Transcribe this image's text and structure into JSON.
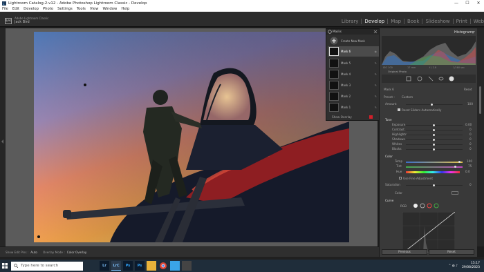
{
  "window": {
    "title": "Lightroom Catalog-2-v12 - Adobe Photoshop Lightroom Classic - Develop",
    "min": "—",
    "max": "☐",
    "close": "✕"
  },
  "menu": [
    "File",
    "Edit",
    "Develop",
    "Photo",
    "Settings",
    "Tools",
    "View",
    "Window",
    "Help"
  ],
  "identity": {
    "logo": "Lrc",
    "product": "Adobe Lightroom Classic",
    "user": "Jack Bird"
  },
  "modules": [
    "Library",
    "Develop",
    "Map",
    "Book",
    "Slideshow",
    "Print",
    "Web"
  ],
  "active_module": "Develop",
  "masks_panel": {
    "title": "Masks",
    "create": "Create New Mask",
    "items": [
      {
        "label": "Mask 6",
        "active": true
      },
      {
        "label": "Mask 5",
        "active": false
      },
      {
        "label": "Mask 4",
        "active": false
      },
      {
        "label": "Mask 3",
        "active": false
      },
      {
        "label": "Mask 2",
        "active": false
      },
      {
        "label": "Mask 1",
        "active": false
      }
    ],
    "show_overlay": "Show Overlay"
  },
  "histogram": {
    "title": "Histogram",
    "readout": [
      "ISO 100",
      "17 mm",
      "f / 2.8",
      "1/160 sec"
    ],
    "original_photo": "Original Photo"
  },
  "mask_panel": {
    "mask_label": "Mask 6",
    "reset": "Reset",
    "preset_label": "Preset :",
    "preset_value": "Custom",
    "amount_label": "Amount",
    "amount_value": "100",
    "reset_sliders": "Reset Sliders Automatically",
    "tone_section": "Tone",
    "tone_sliders": [
      {
        "label": "Exposure",
        "value": "0.00"
      },
      {
        "label": "Contrast",
        "value": "0"
      },
      {
        "label": "Highlights",
        "value": "0"
      },
      {
        "label": "Shadows",
        "value": "0"
      },
      {
        "label": "Whites",
        "value": "0"
      },
      {
        "label": "Blacks",
        "value": "0"
      }
    ],
    "color_section": "Color",
    "temp_label": "Temp",
    "temp_value": "100",
    "tint_label": "Tint",
    "tint_value": "75",
    "hue_label": "Hue",
    "hue_value": "0.0",
    "fine_adjust": "Use Fine Adjustment",
    "saturation_label": "Saturation",
    "saturation_value": "0",
    "color_label": "Color",
    "curve_section": "Curve",
    "curve_channel": "RGB"
  },
  "panel_buttons": {
    "previous": "Previous",
    "reset": "Reset"
  },
  "toolbar": {
    "show_edit_pins": "Show Edit Pins :",
    "show_edit_pins_value": "Auto",
    "overlay_mode": "Overlay Mode :",
    "overlay_mode_value": "Color Overlay"
  },
  "taskbar": {
    "search_placeholder": "Type here to search",
    "time": "15:17",
    "date": "29/08/2023"
  },
  "colors": {
    "accent": "#3d86d9",
    "panel": "#393939",
    "overlay_red": "#d0202a"
  }
}
